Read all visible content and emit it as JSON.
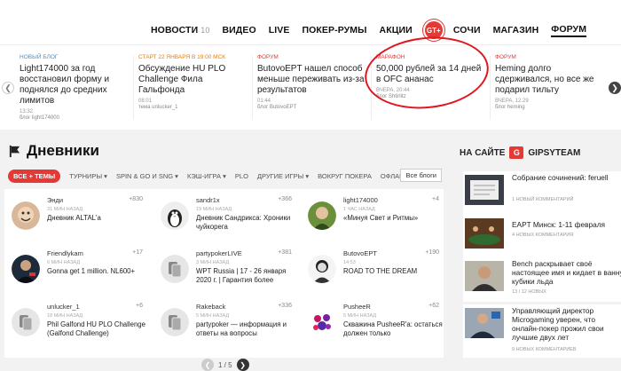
{
  "nav": {
    "items": [
      {
        "label": "НОВОСТИ",
        "count": "10"
      },
      {
        "label": "ВИДЕО"
      },
      {
        "label": "LIVE"
      },
      {
        "label": "ПОКЕР-РУМЫ"
      },
      {
        "label": "АКЦИИ"
      },
      {
        "label": "GT+",
        "logo": true
      },
      {
        "label": "СОЧИ"
      },
      {
        "label": "МАГАЗИН"
      },
      {
        "label": "ФОРУМ",
        "active": true
      }
    ]
  },
  "news": [
    {
      "category": "НОВЫЙ БЛОГ",
      "title": "Light174000 за год восстановил форму и поднялся до средних лимитов",
      "time": "13:32",
      "author": "блог light174000"
    },
    {
      "category": "СТАРТ 22 ЯНВАРЯ В 19:00 МСК",
      "title": "Обсуждение HU PLO Challenge Фила Гальфонда",
      "time": "08:01",
      "author": "тема unlucker_1"
    },
    {
      "category": "ФОРУМ",
      "title": "ButovoEPT нашел способ меньше переживать из-за результатов",
      "time": "01:44",
      "author": "блог ButovoEPT"
    },
    {
      "category": "МАРАФОН",
      "title": "50,000 рублей за 14 дней в OFC ананас",
      "time": "ВЧЕРА, 20:44",
      "author": "блог Shtirlitz"
    },
    {
      "category": "ФОРУМ",
      "title": "Heming долго сдерживался, но все же подарил тильту",
      "time": "ВЧЕРА, 12:29",
      "author": "блог heming"
    }
  ],
  "blogs": {
    "title": "Дневники",
    "filters": [
      "ВСЕ + ТЕМЫ",
      "ТУРНИРЫ",
      "SPIN & GO И SNG",
      "КЭШ-ИГРА",
      "PLO",
      "ДРУГИЕ ИГРЫ",
      "ВОКРУГ ПОКЕРА",
      "ОФЛАЙН"
    ],
    "all_blogs_label": "Все блоги",
    "entries": [
      {
        "name": "Энди",
        "score": "+830",
        "ago": "31 МИН НАЗАД",
        "text": "Дневник ALTAL'а"
      },
      {
        "name": "sandr1x",
        "score": "+366",
        "ago": "19 МИН НАЗАД",
        "text": "Дневник Сандрикса: Хроники чуйкорега"
      },
      {
        "name": "light174000",
        "score": "+4",
        "ago": "1 ЧАС НАЗАД",
        "text": "«Минуя Свет и Ритмы»"
      },
      {
        "name": "Friendlykam",
        "score": "+17",
        "ago": "6 МИН НАЗАД",
        "text": "Gonna get 1 million. NL600+"
      },
      {
        "name": "partypokerLIVE",
        "score": "+381",
        "ago": "3 МИН НАЗАД",
        "text": "WPT Russia | 17 - 26 января 2020 г. | Гарантия более"
      },
      {
        "name": "ButovoEPT",
        "score": "+190",
        "ago": "14:53",
        "text": "ROAD TO THE DREAM"
      },
      {
        "name": "unlucker_1",
        "score": "+6",
        "ago": "18 МИН НАЗАД",
        "text": "Phil Galfond HU PLO Challenge (Galfond Challenge)"
      },
      {
        "name": "Rakeback",
        "score": "+336",
        "ago": "5 МИН НАЗАД",
        "text": "partypoker — информация и ответы на вопросы"
      },
      {
        "name": "PusheeR",
        "score": "+62",
        "ago": "5 МИН НАЗАД",
        "text": "Скважина PusheeR'а: остаться должен только"
      }
    ],
    "pager": {
      "current": "1",
      "total": "5",
      "text": "1 / 5"
    }
  },
  "sidebar": {
    "heading": "НА САЙТЕ",
    "brand": "GIPSYTEAM",
    "items": [
      {
        "title": "Собрание сочинений: feruell",
        "comments": "1 НОВЫЙ КОММЕНТАРИЙ"
      },
      {
        "title": "EAPT Минск: 1-11 февраля",
        "comments": "4 НОВЫХ КОММЕНТАРИЯ"
      },
      {
        "title": "Bench раскрывает своё настоящее имя и кидает в ванну кубики льда",
        "comments": "13 / 12 НОВЫХ"
      },
      {
        "title": "Управляющий директор Microgaming уверен, что онлайн-покер прожил свои лучшие двух лет",
        "comments": "9 НОВЫХ КОММЕНТАРИЕВ"
      }
    ]
  },
  "colors": {
    "accent": "#e53935",
    "link": "#4a90c8"
  }
}
